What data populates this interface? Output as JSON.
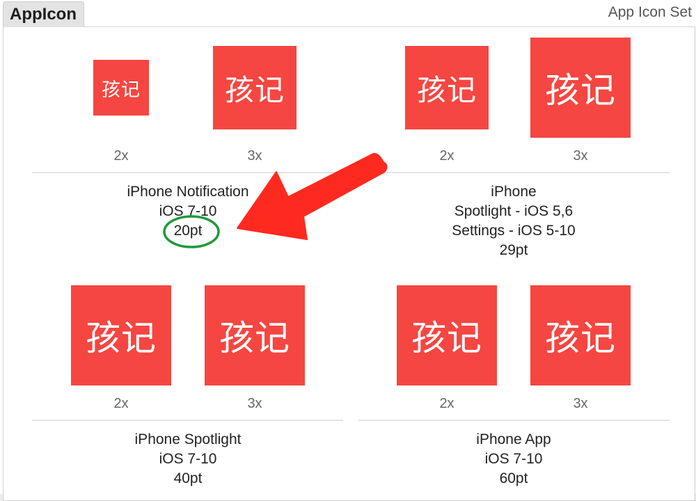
{
  "header": {
    "tab_title": "AppIcon",
    "set_type": "App Icon Set"
  },
  "icon_text": "孩记",
  "colors": {
    "icon_bg": "#f64641",
    "arrow": "#ff2a1f",
    "circle": "#1f9a3a"
  },
  "groups": [
    {
      "scales": [
        "2x",
        "3x"
      ],
      "lines": [
        "iPhone Notification",
        "iOS 7-10",
        "20pt"
      ]
    },
    {
      "scales": [
        "2x",
        "3x"
      ],
      "lines": [
        "iPhone",
        "Spotlight - iOS 5,6",
        "Settings - iOS 5-10",
        "29pt"
      ]
    },
    {
      "scales": [
        "2x",
        "3x"
      ],
      "lines": [
        "iPhone Spotlight",
        "iOS 7-10",
        "40pt"
      ]
    },
    {
      "scales": [
        "2x",
        "3x"
      ],
      "lines": [
        "iPhone App",
        "iOS 7-10",
        "60pt"
      ]
    }
  ]
}
